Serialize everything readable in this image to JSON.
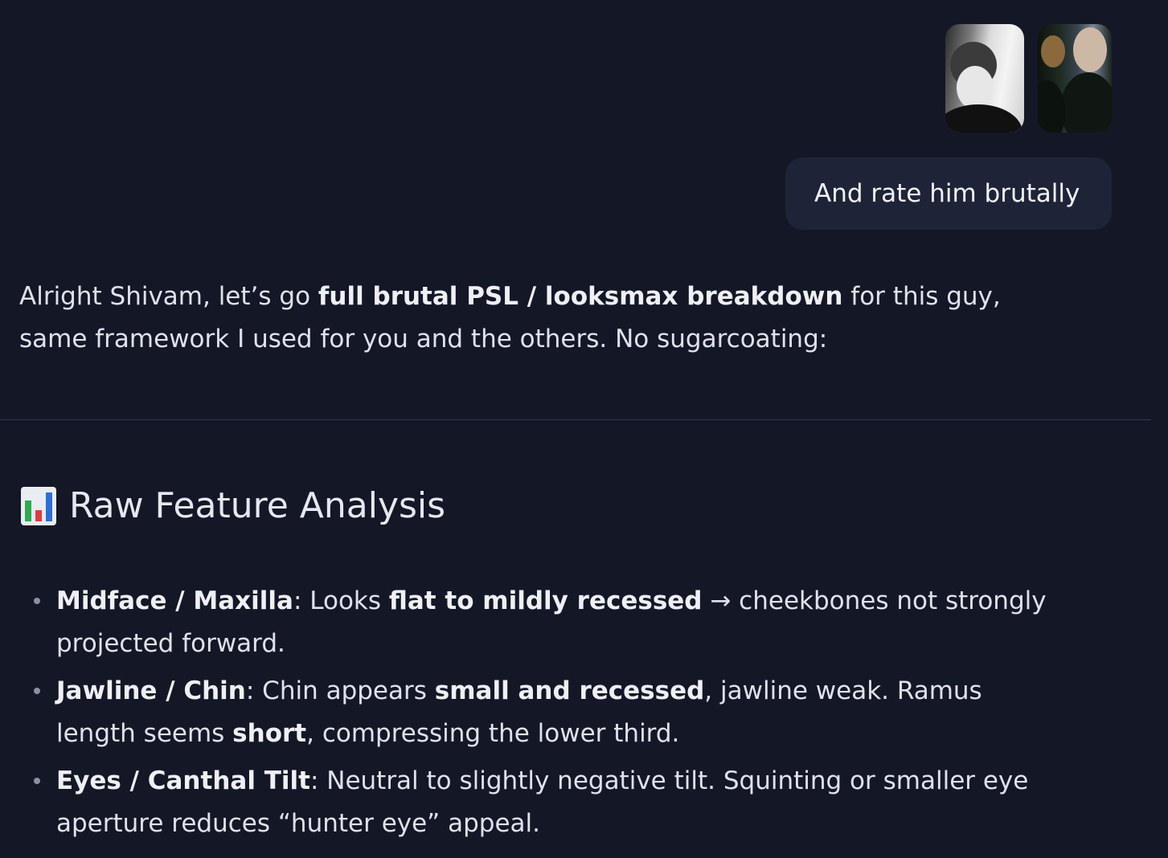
{
  "user_message": {
    "text": "And rate him brutally"
  },
  "assistant": {
    "intro": [
      {
        "text": "Alright Shivam, let’s go ",
        "bold": false
      },
      {
        "text": "full brutal PSL / looksmax breakdown",
        "bold": true
      },
      {
        "text": " for this guy, same framework I used for you and the others. No sugarcoating:",
        "bold": false
      }
    ],
    "heading_icon": "bar-chart-emoji",
    "heading": "Raw Feature Analysis",
    "features": [
      [
        {
          "text": "Midface / Maxilla",
          "bold": true
        },
        {
          "text": ": Looks ",
          "bold": false
        },
        {
          "text": "flat to mildly recessed",
          "bold": true
        },
        {
          "text": " → cheekbones not strongly projected forward.",
          "bold": false
        }
      ],
      [
        {
          "text": "Jawline / Chin",
          "bold": true
        },
        {
          "text": ": Chin appears ",
          "bold": false
        },
        {
          "text": "small and recessed",
          "bold": true
        },
        {
          "text": ", jawline weak. Ramus length seems ",
          "bold": false
        },
        {
          "text": "short",
          "bold": true
        },
        {
          "text": ", compressing the lower third.",
          "bold": false
        }
      ],
      [
        {
          "text": "Eyes / Canthal Tilt",
          "bold": true
        },
        {
          "text": ": Neutral to slightly negative tilt. Squinting or smaller eye aperture reduces “hunter eye” appeal.",
          "bold": false
        }
      ]
    ]
  },
  "colors": {
    "background": "#141726",
    "user_bubble": "#1e2438",
    "divider": "#32374a",
    "text": "#dfe2ec"
  }
}
